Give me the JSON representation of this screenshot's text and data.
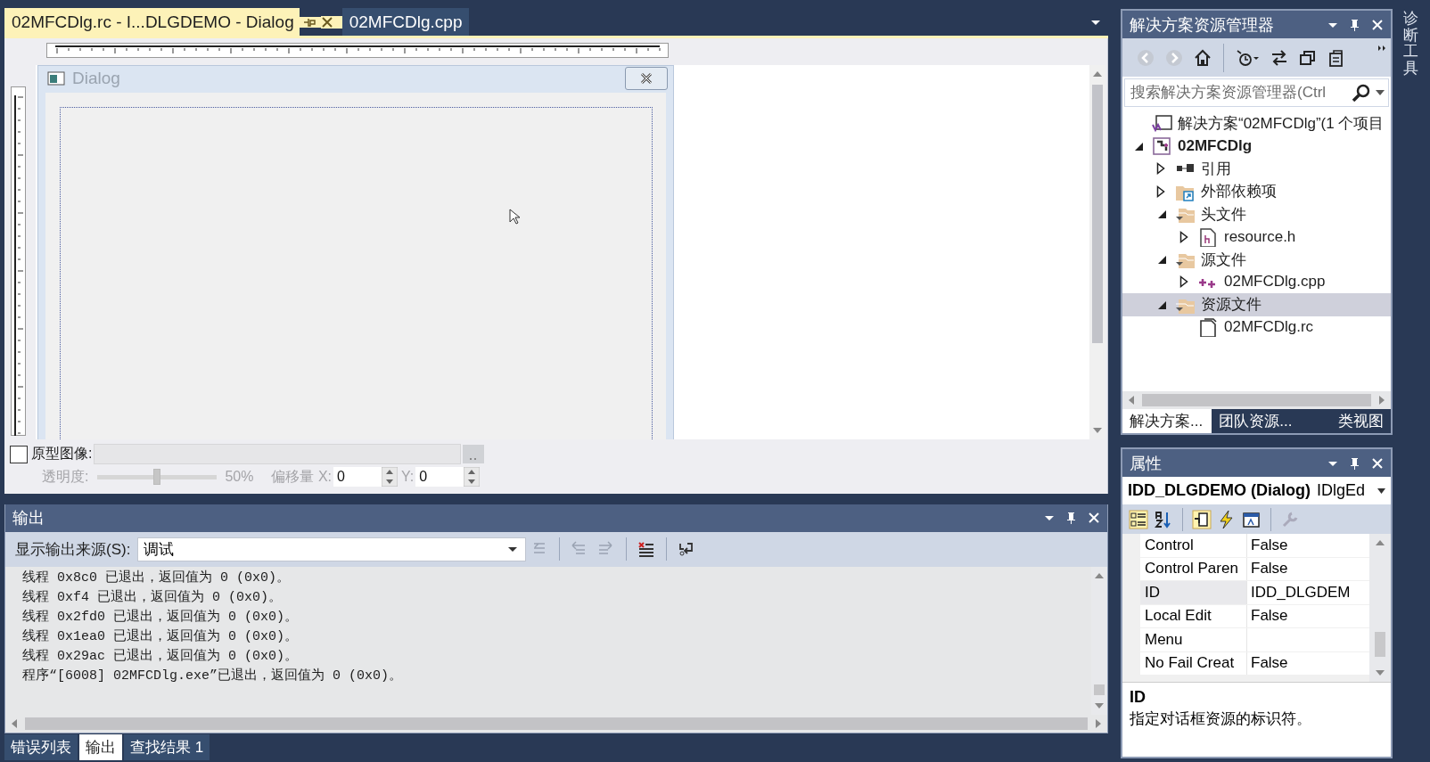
{
  "editor": {
    "tabs": [
      {
        "label": "02MFCDlg.rc - I...DLGDEMO - Dialog",
        "selected": true
      },
      {
        "label": "02MFCDlg.cpp",
        "selected": false
      }
    ],
    "dialog": {
      "title": "Dialog"
    },
    "prototype": {
      "label": "原型图像:",
      "checked": false,
      "transparency_label": "透明度:",
      "level": 0.5,
      "reading": "50%",
      "offset_label": "偏移量 X:",
      "x_value": "0",
      "y_label": "Y:",
      "y_value": "0"
    }
  },
  "output": {
    "title": "输出",
    "source_label": "显示输出来源(S):",
    "source_value": "调试",
    "lines": [
      "线程 0x8c0 已退出，返回值为 0 (0x0)。",
      "线程 0xf4 已退出，返回值为 0 (0x0)。",
      "线程 0x2fd0 已退出，返回值为 0 (0x0)。",
      "线程 0x1ea0 已退出，返回值为 0 (0x0)。",
      "线程 0x29ac 已退出，返回值为 0 (0x0)。",
      "程序“[6008] 02MFCDlg.exe”已退出，返回值为 0 (0x0)。"
    ]
  },
  "bottom_tabs": [
    {
      "label": "错误列表",
      "selected": false
    },
    {
      "label": "输出",
      "selected": true
    },
    {
      "label": "查找结果 1",
      "selected": false
    }
  ],
  "solution_explorer": {
    "title": "解决方案资源管理器",
    "search_placeholder": "搜索解决方案资源管理器(Ctrl",
    "tree": [
      {
        "label": "解决方案“02MFCDlg”(1 个项目",
        "kind": "solution",
        "selected": false,
        "children": [
          {
            "label": "02MFCDlg",
            "kind": "project",
            "expanded": true,
            "selected": false,
            "children": [
              {
                "label": "引用",
                "kind": "references",
                "expanded": false,
                "selected": false
              },
              {
                "label": "外部依赖项",
                "kind": "external",
                "expanded": false,
                "selected": false
              },
              {
                "label": "头文件",
                "kind": "folder",
                "expanded": true,
                "selected": false,
                "children": [
                  {
                    "label": "resource.h",
                    "kind": "header",
                    "expanded": false,
                    "selected": false
                  }
                ]
              },
              {
                "label": "源文件",
                "kind": "folder",
                "expanded": true,
                "selected": false,
                "children": [
                  {
                    "label": "02MFCDlg.cpp",
                    "kind": "cpp",
                    "expanded": false,
                    "selected": false
                  }
                ]
              },
              {
                "label": "资源文件",
                "kind": "folder",
                "expanded": true,
                "selected": true,
                "children": [
                  {
                    "label": "02MFCDlg.rc",
                    "kind": "file",
                    "selected": false
                  }
                ]
              }
            ]
          }
        ]
      }
    ],
    "tabs": [
      {
        "label": "解决方案...",
        "selected": true
      },
      {
        "label": "团队资源...",
        "selected": false
      },
      {
        "label": "类视图",
        "selected": false
      }
    ]
  },
  "properties": {
    "title": "属性",
    "object": "IDD_DLGDEMO (Dialog)",
    "object_type": "IDlgEd",
    "rows": [
      {
        "name": "Control",
        "value": "False",
        "selected": false
      },
      {
        "name": "Control Paren",
        "value": "False",
        "selected": false
      },
      {
        "name": "ID",
        "value": "IDD_DLGDEM",
        "selected": true
      },
      {
        "name": "Local Edit",
        "value": "False",
        "selected": false
      },
      {
        "name": "Menu",
        "selected": false
      },
      {
        "name": "No Fail Creat",
        "value": "False",
        "selected": false
      }
    ],
    "description_title": "ID",
    "description": "指定对话框资源的标识符。"
  },
  "side_strip": {
    "label": "诊断工具"
  }
}
